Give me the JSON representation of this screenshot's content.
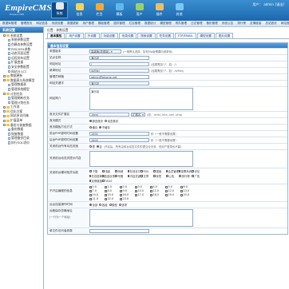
{
  "header": {
    "logo": "EmpireCMS",
    "logo_sub": "Empire CMS",
    "nav": [
      {
        "label": "系统",
        "color": "#e8e8e8"
      },
      {
        "label": "信息",
        "color": "#f4d35e"
      },
      {
        "label": "栏目",
        "color": "#f2a93b"
      },
      {
        "label": "模板",
        "color": "#5fb8e8"
      },
      {
        "label": "用户",
        "color": "#9ad16e"
      },
      {
        "label": "插件",
        "color": "#e9c06a"
      },
      {
        "label": "其他",
        "color": "#7ec6f0"
      }
    ],
    "user_prefix": "用户：",
    "user_name": "admin",
    "logout": "[退出]"
  },
  "submenu": [
    "数据库管理",
    "管理首页",
    "网站信息",
    "系统设置",
    "数据更新",
    "用户管理",
    "模板管理",
    "插件管理",
    "栏目管理",
    "数据统计",
    "模型管理",
    "附件管理",
    "日志管理",
    "备份管理",
    "系统公告",
    "排行榜",
    "友情链接",
    "总站首页",
    "网站首页"
  ],
  "sidebar": {
    "title": "系统设置",
    "items": [
      {
        "label": "系统设置",
        "level": 1,
        "type": "folder"
      },
      {
        "label": "系统参数设置",
        "level": 2,
        "type": "doc"
      },
      {
        "label": "伪静态参数设置",
        "level": 2,
        "type": "doc"
      },
      {
        "label": "RSS/XML参数",
        "level": 2,
        "type": "doc"
      },
      {
        "label": "动态页面设置",
        "level": 2,
        "type": "doc"
      },
      {
        "label": "远程发布设置",
        "level": 2,
        "type": "doc"
      },
      {
        "label": "扩展变量",
        "level": 2,
        "type": "doc"
      },
      {
        "label": "安全参数配置",
        "level": 2,
        "type": "doc"
      },
      {
        "label": "网站分入口",
        "level": 2,
        "type": "doc"
      },
      {
        "label": "数据更新",
        "level": 1,
        "type": "folder"
      },
      {
        "label": "数据表与系统模型",
        "level": 1,
        "type": "folder"
      },
      {
        "label": "管理数据表",
        "level": 2,
        "type": "doc"
      },
      {
        "label": "管理系统模型",
        "level": 2,
        "type": "doc"
      },
      {
        "label": "计划任务",
        "level": 1,
        "type": "folder"
      },
      {
        "label": "管理刷新任务",
        "level": 2,
        "type": "doc"
      },
      {
        "label": "管理计划任务",
        "level": 2,
        "type": "doc"
      },
      {
        "label": "工作流",
        "level": 1,
        "type": "folder"
      },
      {
        "label": "优化方案",
        "level": 1,
        "type": "folder"
      },
      {
        "label": "网站多访问端",
        "level": 1,
        "type": "folder"
      },
      {
        "label": "扩展菜单",
        "level": 1,
        "type": "folder"
      },
      {
        "label": "备份与恢复数据",
        "level": 1,
        "type": "folder"
      },
      {
        "label": "备份数据",
        "level": 2,
        "type": "doc"
      },
      {
        "label": "恢复数据",
        "level": 2,
        "type": "doc"
      },
      {
        "label": "管理备份目录",
        "level": 2,
        "type": "doc"
      },
      {
        "label": "执行SQL语句",
        "level": 2,
        "type": "doc"
      }
    ]
  },
  "breadcrumb": "位置：参数设置",
  "tabs": [
    {
      "label": "基本属性",
      "active": true
    },
    {
      "label": "用户设置",
      "active": false
    },
    {
      "label": "外设置",
      "active": false
    },
    {
      "label": "功能设置",
      "active": false
    },
    {
      "label": "信息设置",
      "active": false
    },
    {
      "label": "搜索设置",
      "active": false
    },
    {
      "label": "任务设置",
      "active": false
    },
    {
      "label": "FTP/EMAIL",
      "active": false
    },
    {
      "label": "模型设置",
      "active": false
    },
    {
      "label": "图片设置",
      "active": false
    }
  ],
  "form": {
    "title": "基本信息设置",
    "rows": {
      "version": {
        "label": "帝国版本",
        "value": "高级版(收费版)",
        "hint": "(一般默认选择，如何Vip版需要向请求你)"
      },
      "site_name": {
        "label": "站点名称",
        "value": "演示站"
      },
      "site_url": {
        "label": "网站地址",
        "value": "/",
        "hint": "(结尾需加\"/\"，如：/)"
      },
      "news_url": {
        "label": "新闻地址",
        "value": "/d/file/",
        "hint": "(结尾需加\"/\"，如：/d/file/)"
      },
      "admin_email": {
        "label": "管理员邮箱",
        "value": "admin@phome.net"
      },
      "keywords": {
        "label": "网站关键字",
        "value": "演示站"
      },
      "description": {
        "label": "网站简介",
        "value": "演示站"
      },
      "index_file": {
        "label": "首页文件扩展名",
        "value": ".html",
        "select": "扩展名",
        "hint": "(如：.html,.htm,.xml,.php)"
      },
      "index_mode": {
        "label": "首页模式",
        "options": [
          "静态首页",
          "动态首页"
        ],
        "selected": 0
      },
      "pack_mode": {
        "label": "首页模板打包方式",
        "options": [
          "缓存",
          "不缓存"
        ],
        "selected": 1
      },
      "php_time": {
        "label": "前台PHP超时时间设置",
        "value": "1000",
        "hint": "秒（一般不需要设置）"
      },
      "php_time2": {
        "label": "后台PHP超时时间设置",
        "value": "1000",
        "hint": "秒（一般不需要设置）"
      },
      "close_site": {
        "label": "关闭前台所有动态页面",
        "options": [
          "是",
          "否"
        ],
        "selected": 1,
        "hint": "(开启后，所有由前台动态文件的提交全无效，但用户登录也不能)"
      },
      "close_hint": {
        "label": "关闭前台动态页提示内容",
        "value": ""
      },
      "close_modules": {
        "label": "关闭前台模块相关功能",
        "items": [
          "下载",
          "电影",
          "商城",
          "在线支付",
          "RSS",
          "搜索",
          "会员管理",
          "投票系统",
          "评论",
          "在线发邮件",
          "信息反馈",
          "专题",
          "内容关键字",
          "文章",
          "标签",
          "公告",
          "排行榜",
          "广告",
          "友情链接",
          "TAGS"
        ],
        "checked": []
      },
      "numbers": {
        "label": "不开启编程的信息",
        "items": [
          "0.0",
          "1.0",
          "2.0",
          "3.0",
          "4.0",
          "5.0",
          "6.0",
          "7.0",
          "8.0",
          "9.0",
          "10.0",
          "11.0",
          "12.0",
          "13.0",
          "14.0",
          "15.0",
          "16.0",
          "17.0",
          "18.0",
          "19.0",
          "20.0",
          "21.0",
          "22.0",
          "23.0"
        ]
      },
      "php_mode": {
        "label": "后台连接操作时间",
        "options": [
          "全部",
          "各组",
          "模型",
          "选项"
        ],
        "selected": 0
      },
      "ftp_save": {
        "label": "远程保存忽略地址",
        "sub": "(一行为一个地址)",
        "value": ""
      },
      "last": {
        "label": "单文件访问者参数",
        "value": ""
      }
    }
  }
}
